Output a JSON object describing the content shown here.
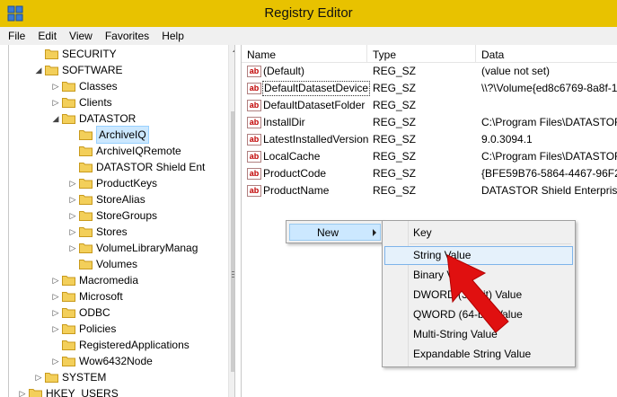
{
  "window": {
    "title": "Registry Editor"
  },
  "menu": [
    "File",
    "Edit",
    "View",
    "Favorites",
    "Help"
  ],
  "tree": {
    "items": [
      {
        "label": "SECURITY",
        "level": 3,
        "expander": "none"
      },
      {
        "label": "SOFTWARE",
        "level": 3,
        "expander": "expanded"
      },
      {
        "label": "Classes",
        "level": 4,
        "expander": "collapsed"
      },
      {
        "label": "Clients",
        "level": 4,
        "expander": "collapsed"
      },
      {
        "label": "DATASTOR",
        "level": 4,
        "expander": "expanded"
      },
      {
        "label": "ArchiveIQ",
        "level": 5,
        "expander": "none",
        "selected": true
      },
      {
        "label": "ArchiveIQRemote",
        "level": 5,
        "expander": "none"
      },
      {
        "label": "DATASTOR Shield Ent",
        "level": 5,
        "expander": "none"
      },
      {
        "label": "ProductKeys",
        "level": 5,
        "expander": "collapsed"
      },
      {
        "label": "StoreAlias",
        "level": 5,
        "expander": "collapsed"
      },
      {
        "label": "StoreGroups",
        "level": 5,
        "expander": "collapsed"
      },
      {
        "label": "Stores",
        "level": 5,
        "expander": "collapsed"
      },
      {
        "label": "VolumeLibraryManag",
        "level": 5,
        "expander": "collapsed"
      },
      {
        "label": "Volumes",
        "level": 5,
        "expander": "none"
      },
      {
        "label": "Macromedia",
        "level": 4,
        "expander": "collapsed"
      },
      {
        "label": "Microsoft",
        "level": 4,
        "expander": "collapsed"
      },
      {
        "label": "ODBC",
        "level": 4,
        "expander": "collapsed"
      },
      {
        "label": "Policies",
        "level": 4,
        "expander": "collapsed"
      },
      {
        "label": "RegisteredApplications",
        "level": 4,
        "expander": "none"
      },
      {
        "label": "Wow6432Node",
        "level": 4,
        "expander": "collapsed"
      },
      {
        "label": "SYSTEM",
        "level": 3,
        "expander": "collapsed"
      },
      {
        "label": "HKEY_USERS",
        "level": 2,
        "expander": "collapsed"
      }
    ]
  },
  "list": {
    "columns": [
      "Name",
      "Type",
      "Data"
    ],
    "rows": [
      {
        "name": "(Default)",
        "type": "REG_SZ",
        "data": "(value not set)"
      },
      {
        "name": "DefaultDatasetDevice",
        "type": "REG_SZ",
        "data": "\\\\?\\Volume{ed8c6769-8a8f-1",
        "focused": true
      },
      {
        "name": "DefaultDatasetFolder",
        "type": "REG_SZ",
        "data": ""
      },
      {
        "name": "InstallDir",
        "type": "REG_SZ",
        "data": "C:\\Program Files\\DATASTOR"
      },
      {
        "name": "LatestInstalledVersion",
        "type": "REG_SZ",
        "data": "9.0.3094.1"
      },
      {
        "name": "LocalCache",
        "type": "REG_SZ",
        "data": "C:\\Program Files\\DATASTOR"
      },
      {
        "name": "ProductCode",
        "type": "REG_SZ",
        "data": "{BFE59B76-5864-4467-96F2-F"
      },
      {
        "name": "ProductName",
        "type": "REG_SZ",
        "data": "DATASTOR Shield Enterprise"
      }
    ]
  },
  "context_menu": {
    "item": "New"
  },
  "submenu": {
    "items": [
      {
        "label": "Key"
      },
      {
        "label": "String Value",
        "hover": true
      },
      {
        "label": "Binary Value"
      },
      {
        "label": "DWORD (32-bit) Value"
      },
      {
        "label": "QWORD (64-bit) Value"
      },
      {
        "label": "Multi-String Value"
      },
      {
        "label": "Expandable String Value"
      }
    ]
  },
  "colors": {
    "titlebar": "#e8c200",
    "selection": "#cce8ff",
    "arrow": "#e01010"
  },
  "icons": {
    "app": "registry-editor-icon",
    "folder": "folder-icon",
    "value": "string-value-icon"
  }
}
